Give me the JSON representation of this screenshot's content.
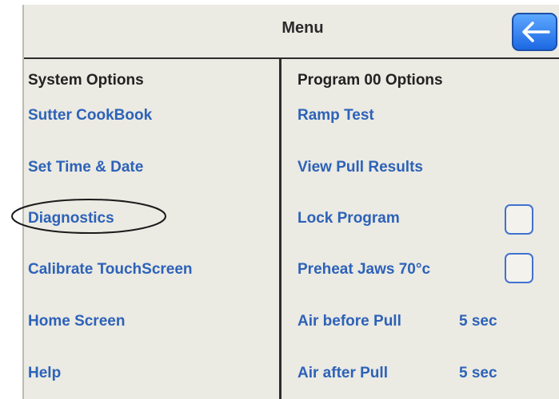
{
  "menu": {
    "title": "Menu",
    "back_icon": "left-arrow-icon"
  },
  "system_options": {
    "heading": "System Options",
    "items": [
      {
        "label": "Sutter CookBook"
      },
      {
        "label": "Set Time & Date"
      },
      {
        "label": "Diagnostics",
        "circled": true
      },
      {
        "label": "Calibrate TouchScreen"
      },
      {
        "label": "Home Screen"
      },
      {
        "label": "Help"
      }
    ]
  },
  "program_options": {
    "heading": "Program 00 Options",
    "items": [
      {
        "label": "Ramp Test"
      },
      {
        "label": "View Pull Results"
      },
      {
        "label": "Lock Program",
        "checked": false
      },
      {
        "label": "Preheat Jaws 70°c",
        "checked": false
      },
      {
        "label": "Air before Pull",
        "value": "5 sec"
      },
      {
        "label": "Air after Pull",
        "value": "5 sec"
      }
    ]
  },
  "colors": {
    "panel_bg": "#ebeae3",
    "link_text": "#2d62b8",
    "back_button": "#3a86f0"
  }
}
